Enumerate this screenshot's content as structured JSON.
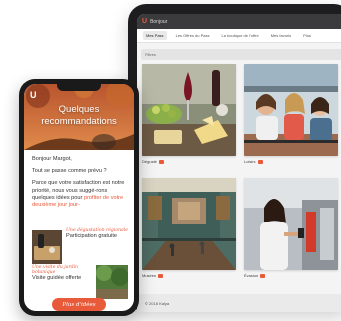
{
  "tablet": {
    "logo": "U",
    "brand": "Bonjour",
    "nav": [
      "Mes Pass",
      "Les Offres du Pass",
      "La boutique de l'offre",
      "Mes favoris",
      "Plus"
    ],
    "filter_label": "Filtres",
    "cards": [
      {
        "label": "Dégusté"
      },
      {
        "label": "Loisirs"
      },
      {
        "label": "Musées"
      },
      {
        "label": "Évasion"
      }
    ],
    "footer": "© 2018 Kalya",
    "colors": {
      "accent": "#e85a3a",
      "frame": "#1d1d1f"
    }
  },
  "phone": {
    "logo": "U",
    "hero_title": "Quelques recommandations",
    "greeting": "Bonjour Margot,",
    "line2": "Tout se passe comme prévu ?",
    "para_main": "Parce que votre satisfaction est notre priorité, nous vous suggé-rons quelques idées pour",
    "para_accent": "profiter de votre deuxième jour jour-",
    "promo1": {
      "title": "Une dégustation régionale",
      "subtitle": "Participation gratuite"
    },
    "promo2": {
      "title": "Une visite du jardin botanique",
      "subtitle": "Visite guidée offerte"
    },
    "cta": "Plus d'idées"
  }
}
